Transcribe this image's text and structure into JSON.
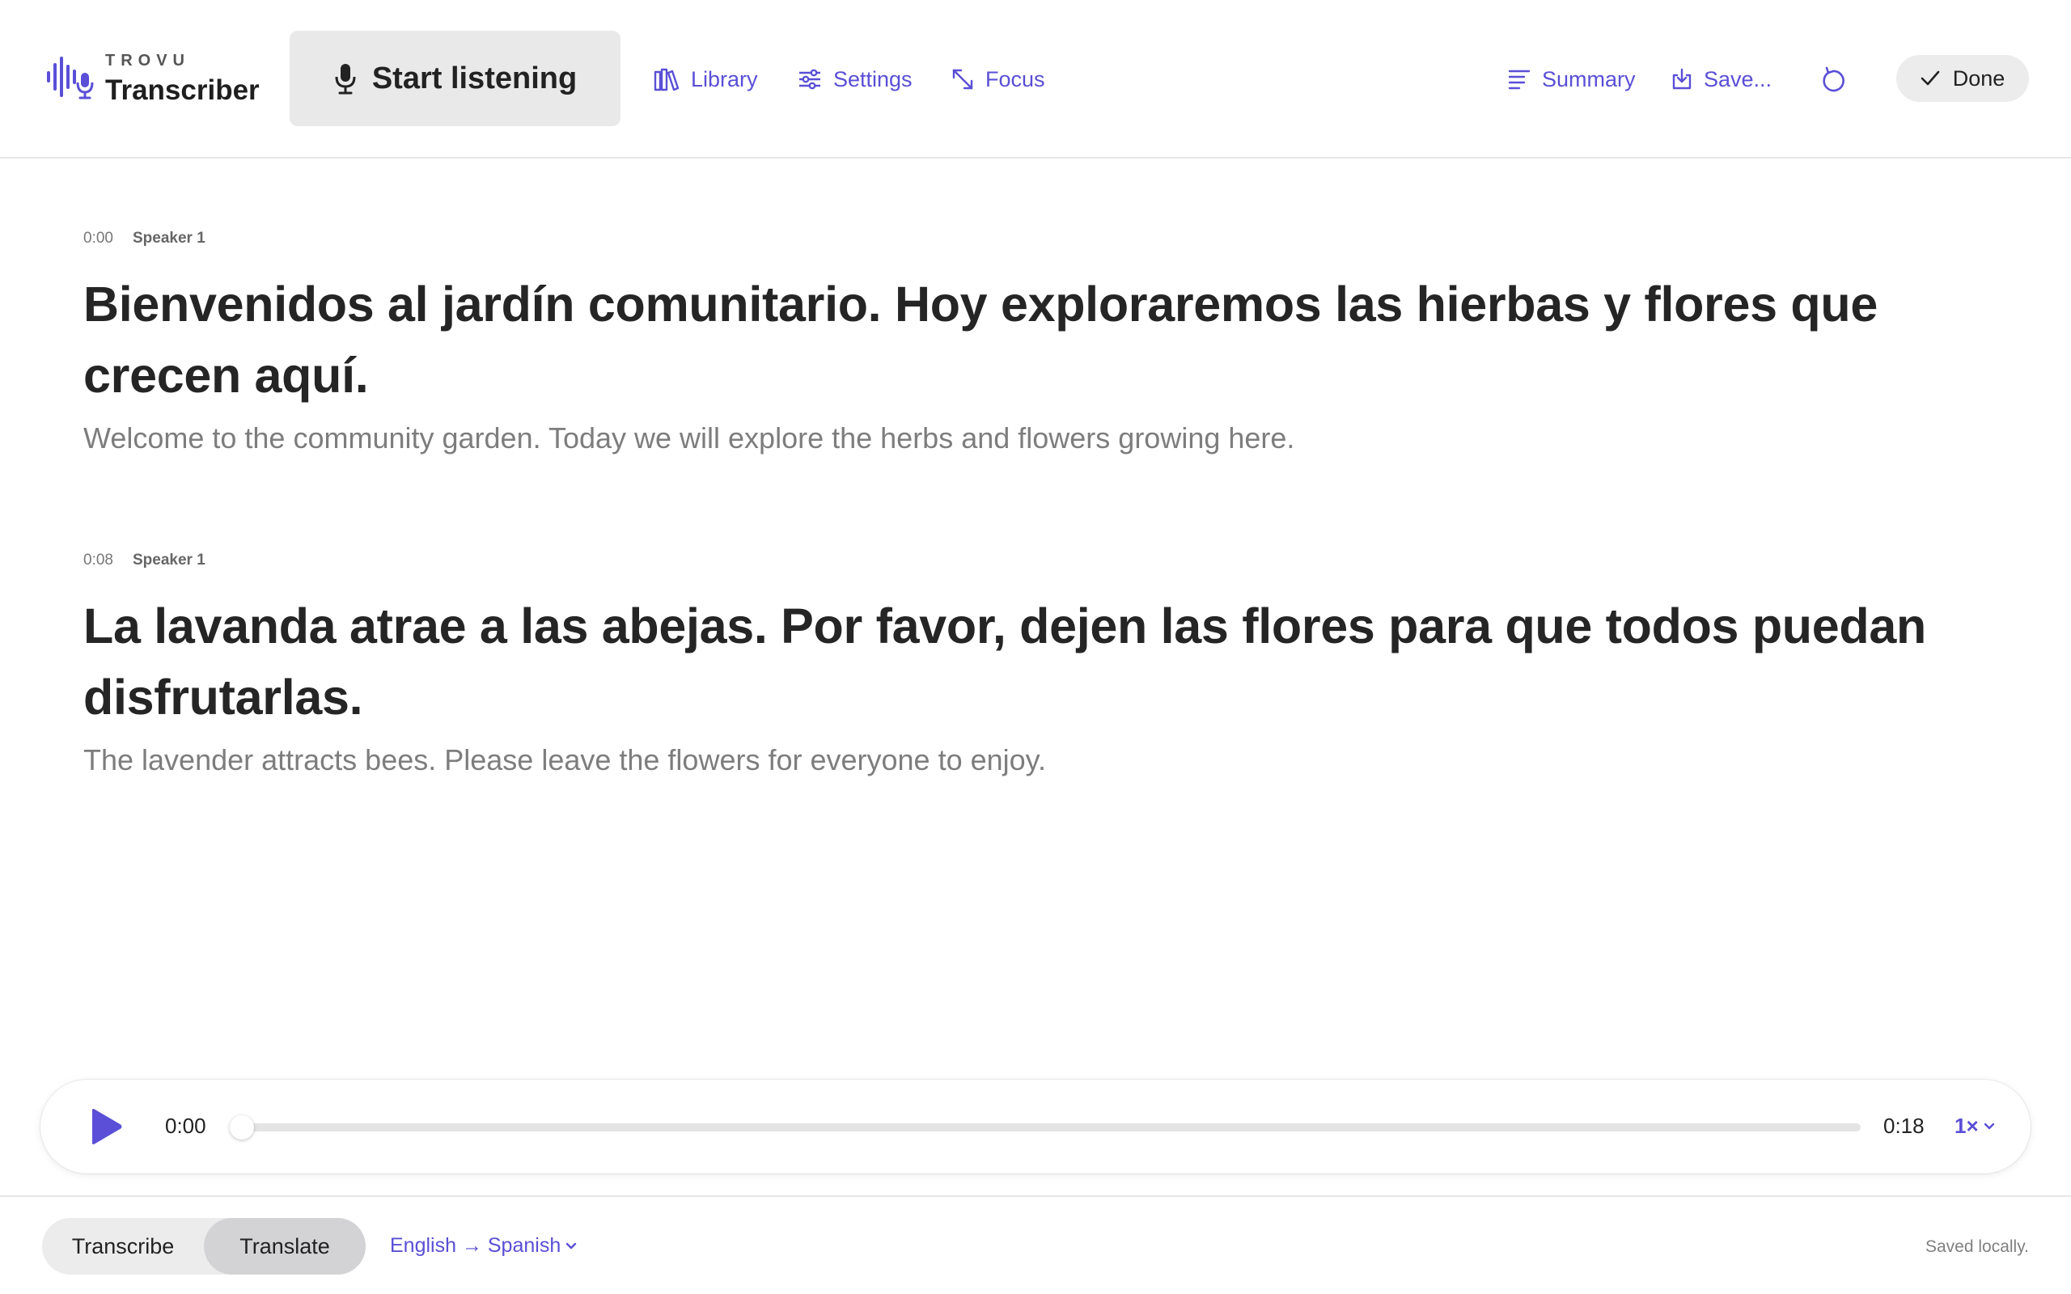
{
  "app": {
    "brand_small": "TROVU",
    "brand_name": "Transcriber"
  },
  "toolbar": {
    "start_label": "Start listening",
    "library_label": "Library",
    "settings_label": "Settings",
    "focus_label": "Focus",
    "summary_label": "Summary",
    "save_label": "Save...",
    "done_label": "Done"
  },
  "transcript": [
    {
      "time": "0:00",
      "speaker": "Speaker 1",
      "original": "Bienvenidos al jardín comunitario. Hoy exploraremos las hierbas y flores que crecen aquí.",
      "translation": "Welcome to the community garden. Today we will explore the herbs and flowers growing here."
    },
    {
      "time": "0:08",
      "speaker": "Speaker 1",
      "original": "La lavanda atrae a las abejas. Por favor, dejen las flores para que todos puedan disfrutarlas.",
      "translation": "The lavender attracts bees. Please leave the flowers for everyone to enjoy."
    }
  ],
  "player": {
    "current_time": "0:00",
    "total_time": "0:18",
    "speed": "1×",
    "progress": 0
  },
  "footer": {
    "mode_transcribe": "Transcribe",
    "mode_translate": "Translate",
    "active_mode": "Translate",
    "language_pair": "English → Spanish",
    "status": "Saved locally."
  },
  "colors": {
    "accent": "#5a4fd6",
    "text": "#222222",
    "muted": "#7d7d7d"
  }
}
